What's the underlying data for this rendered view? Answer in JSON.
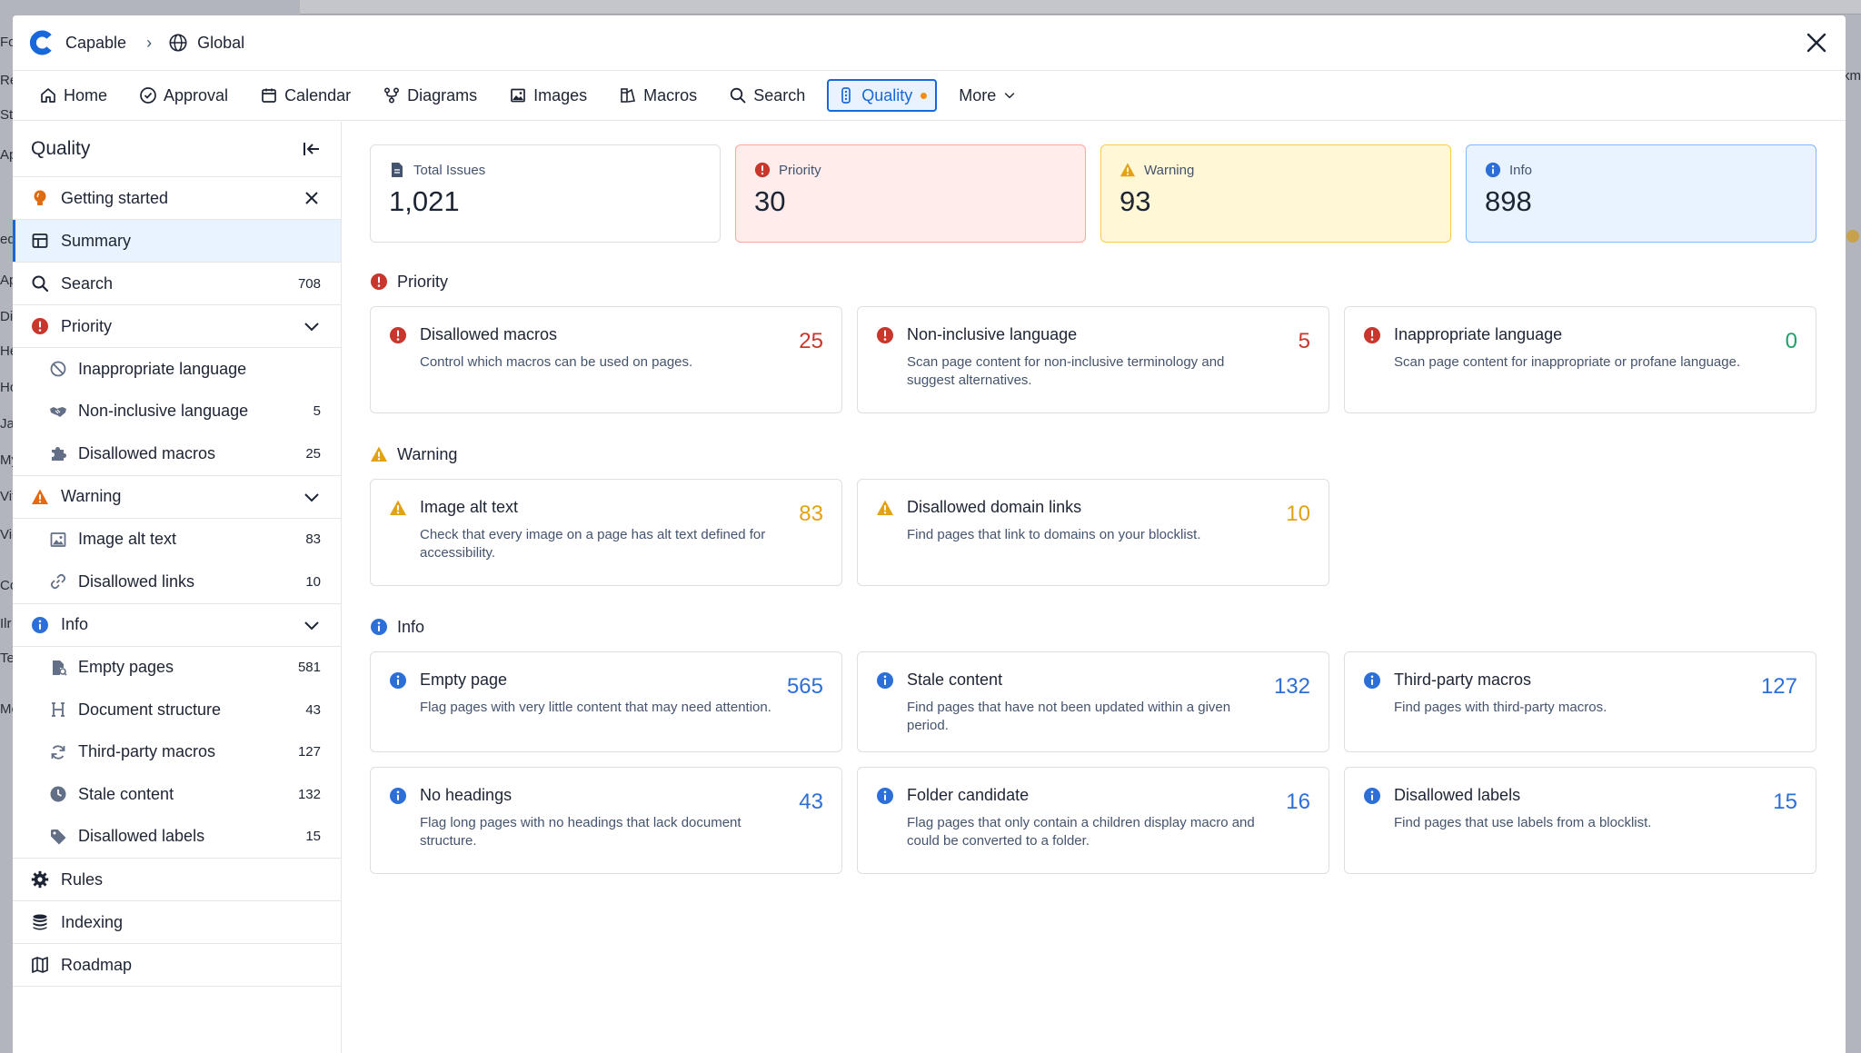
{
  "background": {
    "left_fragments": [
      "Fo",
      "Re",
      "Sta",
      "Ap",
      "ed",
      "Ap",
      "Dia",
      "He",
      "Ho",
      "Ja",
      "My",
      "Vit",
      "Vie",
      "Co",
      "Ilr",
      "Te",
      "Mo"
    ],
    "right_fragment": "km"
  },
  "header": {
    "app_name": "Capable",
    "scope": "Global"
  },
  "nav": {
    "items": [
      {
        "label": "Home",
        "icon": "home-icon"
      },
      {
        "label": "Approval",
        "icon": "check-circle-icon"
      },
      {
        "label": "Calendar",
        "icon": "calendar-icon"
      },
      {
        "label": "Diagrams",
        "icon": "diagram-icon"
      },
      {
        "label": "Images",
        "icon": "image-icon"
      },
      {
        "label": "Macros",
        "icon": "macros-icon"
      },
      {
        "label": "Search",
        "icon": "search-icon"
      },
      {
        "label": "Quality",
        "icon": "traffic-light-icon"
      },
      {
        "label": "More",
        "icon": "chevron-down-icon"
      }
    ]
  },
  "sidebar": {
    "title": "Quality",
    "getting_started": "Getting started",
    "summary": "Summary",
    "search": {
      "label": "Search",
      "count": "708"
    },
    "priority": {
      "label": "Priority",
      "items": [
        {
          "label": "Inappropriate language",
          "count": ""
        },
        {
          "label": "Non-inclusive language",
          "count": "5"
        },
        {
          "label": "Disallowed macros",
          "count": "25"
        }
      ]
    },
    "warning": {
      "label": "Warning",
      "items": [
        {
          "label": "Image alt text",
          "count": "83"
        },
        {
          "label": "Disallowed links",
          "count": "10"
        }
      ]
    },
    "info": {
      "label": "Info",
      "items": [
        {
          "label": "Empty pages",
          "count": "581"
        },
        {
          "label": "Document structure",
          "count": "43"
        },
        {
          "label": "Third-party macros",
          "count": "127"
        },
        {
          "label": "Stale content",
          "count": "132"
        },
        {
          "label": "Disallowed labels",
          "count": "15"
        }
      ]
    },
    "rules": "Rules",
    "indexing": "Indexing",
    "roadmap": "Roadmap"
  },
  "stats": {
    "total": {
      "label": "Total Issues",
      "value": "1,021"
    },
    "priority": {
      "label": "Priority",
      "value": "30"
    },
    "warning": {
      "label": "Warning",
      "value": "93"
    },
    "info": {
      "label": "Info",
      "value": "898"
    }
  },
  "sections": {
    "priority": {
      "title": "Priority",
      "cards": [
        {
          "title": "Disallowed macros",
          "count": "25",
          "desc": "Control which macros can be used on pages."
        },
        {
          "title": "Non-inclusive language",
          "count": "5",
          "desc": "Scan page content for non-inclusive terminology and suggest alternatives."
        },
        {
          "title": "Inappropriate language",
          "count": "0",
          "desc": "Scan page content for inappropriate or profane language."
        }
      ]
    },
    "warning": {
      "title": "Warning",
      "cards": [
        {
          "title": "Image alt text",
          "count": "83",
          "desc": "Check that every image on a page has alt text defined for accessibility."
        },
        {
          "title": "Disallowed domain links",
          "count": "10",
          "desc": "Find pages that link to domains on your blocklist."
        }
      ]
    },
    "info": {
      "title": "Info",
      "cards": [
        {
          "title": "Empty page",
          "count": "565",
          "desc": "Flag pages with very little content that may need attention."
        },
        {
          "title": "Stale content",
          "count": "132",
          "desc": "Find pages that have not been updated within a given period."
        },
        {
          "title": "Third-party macros",
          "count": "127",
          "desc": "Find pages with third-party macros."
        },
        {
          "title": "No headings",
          "count": "43",
          "desc": "Flag long pages with no headings that lack document structure."
        },
        {
          "title": "Folder candidate",
          "count": "16",
          "desc": "Flag pages that only contain a children display macro and could be converted to a folder."
        },
        {
          "title": "Disallowed labels",
          "count": "15",
          "desc": "Find pages that use labels from a blocklist."
        }
      ]
    }
  },
  "colors": {
    "accent": "#1868db",
    "priority": "#c9372c",
    "warning": "#e2a212",
    "info": "#2d6fd9",
    "ok": "#22a06b"
  }
}
